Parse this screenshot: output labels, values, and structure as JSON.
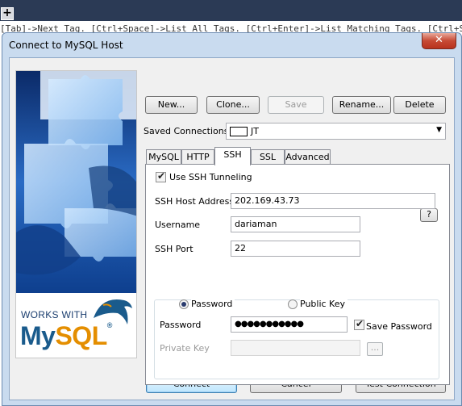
{
  "background": {
    "plus_label": "+",
    "hint_text": "[Tab]->Next Tag. [Ctrl+Space]->List All Tags. [Ctrl+Enter]->List Matching Tags. [Ctrl+Shift+Space]"
  },
  "dialog": {
    "title": "Connect to MySQL Host",
    "close_label": "✕"
  },
  "branding": {
    "works_with": "WORKS WITH",
    "mysql_my": "My",
    "mysql_sql": "SQL",
    "registered": "®",
    "dolphin_icon": "mysql-dolphin-logo"
  },
  "toolbar": {
    "new_label": "New...",
    "clone_label": "Clone...",
    "save_label": "Save",
    "rename_label": "Rename...",
    "delete_label": "Delete"
  },
  "saved_connections": {
    "label": "Saved Connections",
    "value": "JT"
  },
  "tabs": [
    {
      "label": "MySQL"
    },
    {
      "label": "HTTP"
    },
    {
      "label": "SSH"
    },
    {
      "label": "SSL"
    },
    {
      "label": "Advanced"
    }
  ],
  "active_tab": "SSH",
  "ssh": {
    "use_tunneling_label": "Use SSH Tunneling",
    "use_tunneling_checked": true,
    "help_label": "?",
    "host_label": "SSH Host Address",
    "host_value": "202.169.43.73",
    "username_label": "Username",
    "username_value": "dariaman",
    "port_label": "SSH Port",
    "port_value": "22",
    "auth_password_label": "Password",
    "auth_publickey_label": "Public Key",
    "auth_selected": "Password",
    "password_label": "Password",
    "password_value": "●●●●●●●●●●●",
    "save_password_label": "Save Password",
    "save_password_checked": true,
    "private_key_label": "Private Key",
    "private_key_value": "",
    "browse_label": "..."
  },
  "footer": {
    "connect_label": "Connect",
    "cancel_label": "Cancel",
    "test_label": "Test Connection"
  }
}
